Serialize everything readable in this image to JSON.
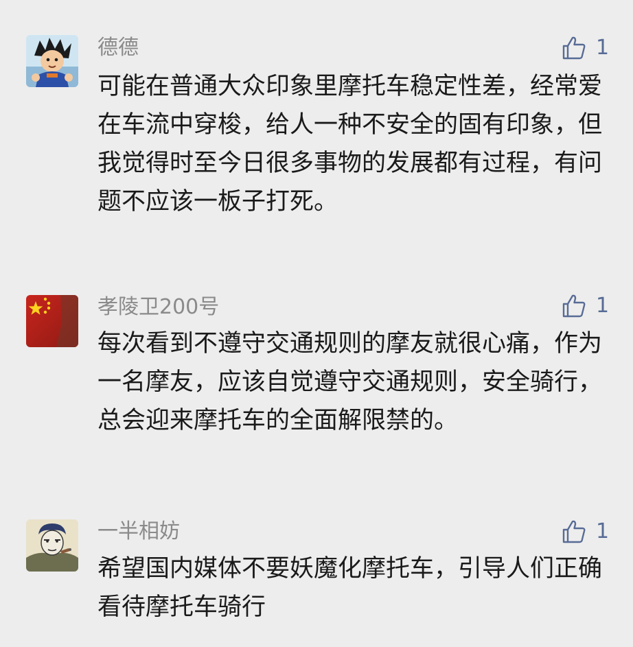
{
  "comments": [
    {
      "name": "德德",
      "like_count": "1",
      "text": "可能在普通大众印象里摩托车稳定性差，经常爱在车流中穿梭，给人一种不安全的固有印象，但我觉得时至今日很多事物的发展都有过程，有问题不应该一板子打死。",
      "avatar_icon": "cartoon-boy-avatar-icon"
    },
    {
      "name": "孝陵卫200号",
      "like_count": "1",
      "text": "每次看到不遵守交通规则的摩友就很心痛，作为一名摩友，应该自觉遵守交通规则，安全骑行，总会迎来摩托车的全面解限禁的。",
      "avatar_icon": "china-flag-avatar-icon"
    },
    {
      "name": "一半相妨",
      "like_count": "1",
      "text": "希望国内媒体不要妖魔化摩托车，引导人们正确看待摩托车骑行",
      "avatar_icon": "sketch-portrait-avatar-icon"
    }
  ],
  "colors": {
    "background": "#ededed",
    "name": "#8a8a8a",
    "like_accent": "#576b95",
    "text": "#1a1a1a"
  }
}
